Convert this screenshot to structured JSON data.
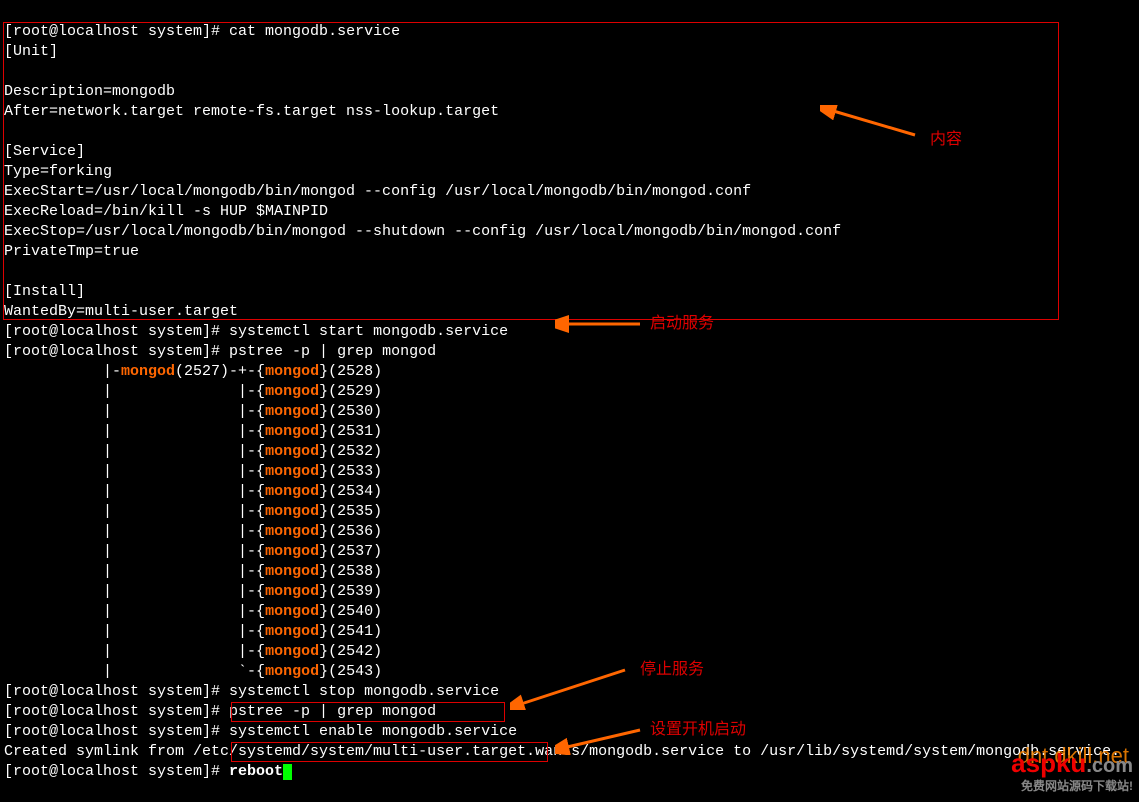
{
  "prompts": {
    "p1": "[root@localhost system]# ",
    "p2": "[root@localhost system]# ",
    "p3": "[root@localhost system]# ",
    "p4": "[root@localhost system]# ",
    "p5": "[root@localhost system]# ",
    "p6": "[root@localhost system]# ",
    "p7": "[root@localhost system]# "
  },
  "cmds": {
    "cat": "cat mongodb.service",
    "start": "systemctl start mongodb.service",
    "pstree1": "pstree -p | grep mongod",
    "stop": "systemctl stop mongodb.service",
    "pstree2": "pstree -p | grep mongod",
    "enable": "systemctl enable mongodb.service",
    "reboot": "reboot"
  },
  "service_file": {
    "l1": "[Unit]",
    "l2": "",
    "l3": "Description=mongodb",
    "l4": "After=network.target remote-fs.target nss-lookup.target",
    "l5": "",
    "l6": "[Service]",
    "l7": "Type=forking",
    "l8": "ExecStart=/usr/local/mongodb/bin/mongod --config /usr/local/mongodb/bin/mongod.conf",
    "l9": "ExecReload=/bin/kill -s HUP $MAINPID",
    "l10": "ExecStop=/usr/local/mongodb/bin/mongod --shutdown --config /usr/local/mongodb/bin/mongod.conf",
    "l11": "PrivateTmp=true",
    "l12": "",
    "l13": "[Install]",
    "l14": "WantedBy=multi-user.target"
  },
  "pstree": {
    "head_pre": "           |-",
    "head_name": "mongod",
    "head_mid": "(2527)-+-{",
    "head_name2": "mongod",
    "head_end": "}(2528)",
    "pipe": "           |              ",
    "branch": "|-{",
    "lastbranch": "`-{",
    "name": "mongod",
    "endfmt": "}(",
    "close": ")",
    "pids": [
      "2529",
      "2530",
      "2531",
      "2532",
      "2533",
      "2534",
      "2535",
      "2536",
      "2537",
      "2538",
      "2539",
      "2540",
      "2541",
      "2542",
      "2543"
    ]
  },
  "symlink": "Created symlink from /etc/systemd/system/multi-user.target.wants/mongodb.service to /usr/lib/systemd/system/mongodb.service.",
  "annotations": {
    "content": "内容",
    "start_service": "启动服务",
    "stop_service": "停止服务",
    "set_boot": "设置开机启动"
  },
  "watermarks": {
    "w1": "dnt.dkill.net",
    "w2_brand": "aspku",
    "w2_dom": ".com",
    "w2_sub": "免费网站源码下载站!"
  }
}
